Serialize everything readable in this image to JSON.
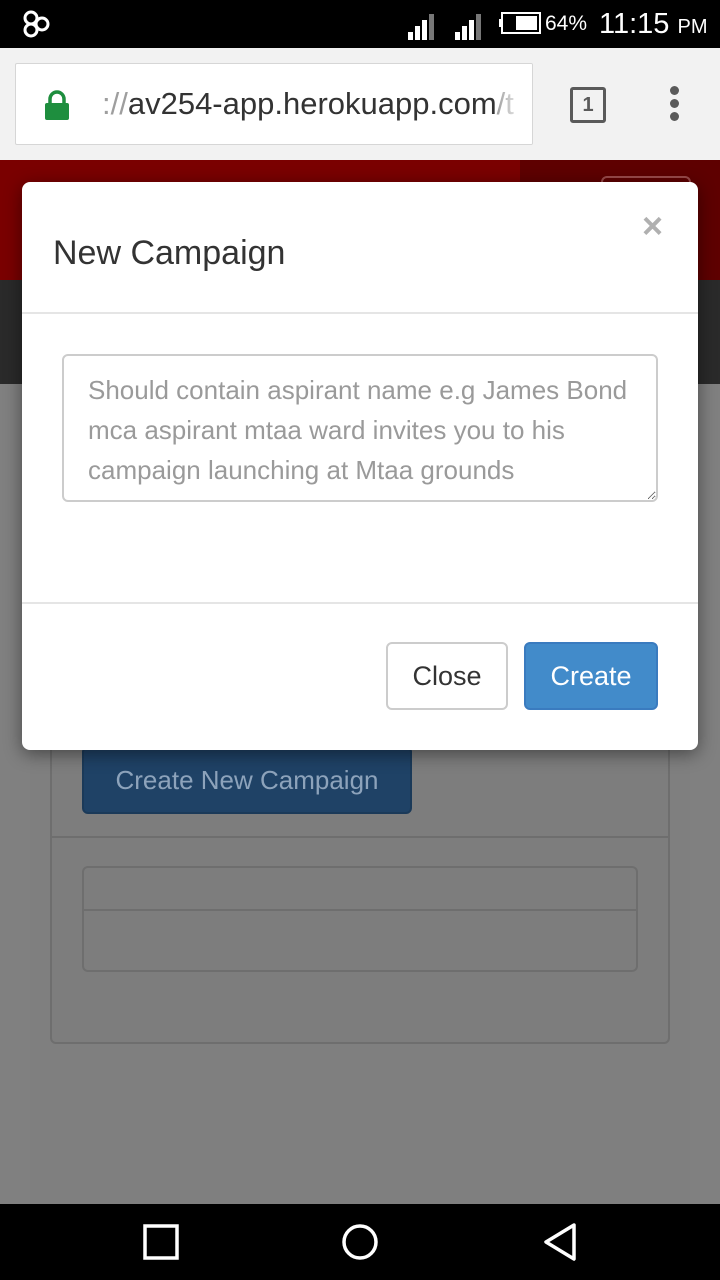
{
  "status_bar": {
    "battery_percent": "64%",
    "time": "11:15",
    "ampm": "PM",
    "icons": [
      "app-logo-icon",
      "signal-icon",
      "signal-icon",
      "battery-icon"
    ]
  },
  "browser": {
    "url_scheme": "://",
    "url_host": "av254-app.herokuapp.com",
    "url_path": "/t",
    "tab_count": "1",
    "lock_color": "#1e8e3e"
  },
  "page": {
    "create_new_campaign_label": "Create New Campaign"
  },
  "modal": {
    "title": "New Campaign",
    "close_symbol": "×",
    "textarea_placeholder": "Should contain aspirant name e.g James Bond mca aspirant mtaa ward invites you to his campaign launching at Mtaa grounds",
    "textarea_value": "",
    "close_button_label": "Close",
    "create_button_label": "Create",
    "accent_color": "#428bca"
  },
  "nav_bar": {
    "icons": [
      "recents-icon",
      "home-icon",
      "back-icon"
    ]
  }
}
